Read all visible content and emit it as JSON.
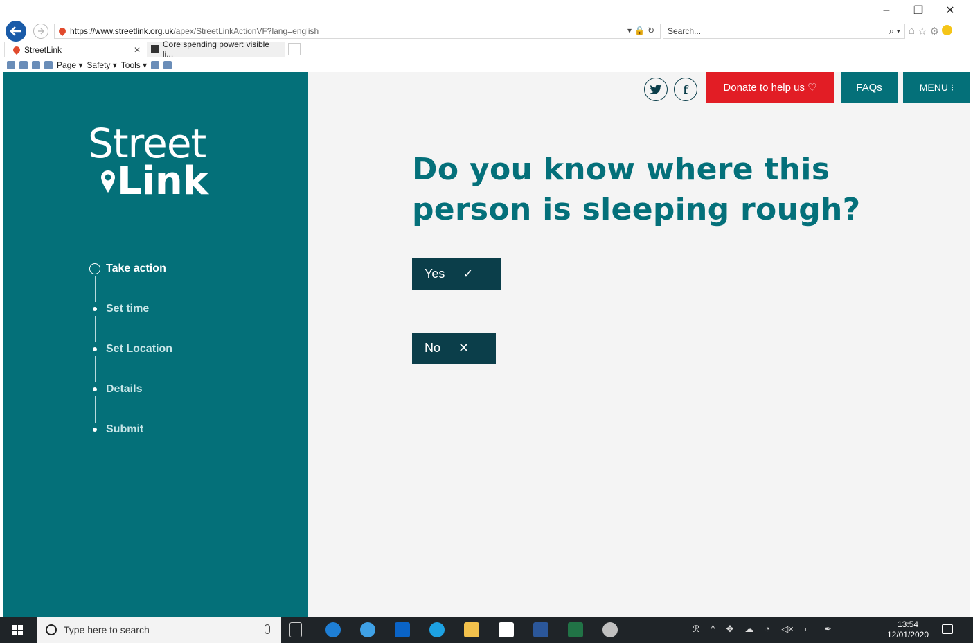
{
  "browser": {
    "window_controls": {
      "minimize": "–",
      "restore": "❐",
      "close": "✕"
    },
    "address": {
      "host": "https://www.streetlink.org.uk",
      "path": "/apex/StreetLinkActionVF?lang=english"
    },
    "search_placeholder": "Search...",
    "tabs": [
      {
        "label": "StreetLink",
        "active": true,
        "close": "✕"
      },
      {
        "label": "Core spending power: visible li...",
        "active": false
      }
    ],
    "command_bar": {
      "page": "Page ▾",
      "safety": "Safety ▾",
      "tools": "Tools ▾"
    }
  },
  "header": {
    "twitter_icon": "twitter-icon",
    "facebook_icon": "facebook-icon",
    "donate_label": "Donate to help us ♡",
    "faqs_label": "FAQs",
    "menu_label": "MENU ⁝"
  },
  "sidebar": {
    "logo_line1": "Street",
    "logo_line2": "Link",
    "steps": [
      {
        "label": "Take action",
        "state": "current"
      },
      {
        "label": "Set time",
        "state": "pending"
      },
      {
        "label": "Set Location",
        "state": "pending"
      },
      {
        "label": "Details",
        "state": "pending"
      },
      {
        "label": "Submit",
        "state": "pending"
      }
    ]
  },
  "main": {
    "question": "Do you know where this person is sleeping rough?",
    "answers": [
      {
        "label": "Yes",
        "icon": "✓"
      },
      {
        "label": "No",
        "icon": "✕"
      }
    ]
  },
  "taskbar": {
    "search_placeholder": "Type here to search",
    "time": "13:54",
    "date": "12/01/2020"
  },
  "colors": {
    "teal": "#047079",
    "dark_teal": "#0b3e4a",
    "donate_red": "#e21d25",
    "page_bg": "#f4f4f4"
  }
}
